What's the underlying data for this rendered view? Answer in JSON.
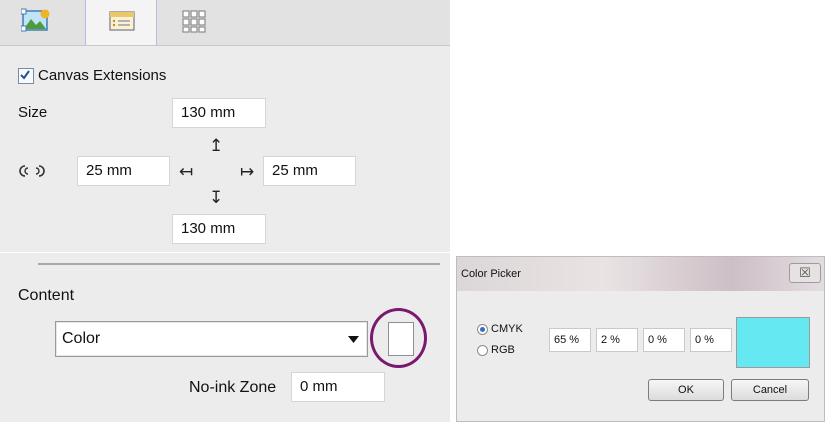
{
  "tabs": [
    {
      "icon": "image-icon",
      "selected": false
    },
    {
      "icon": "layout-icon",
      "selected": true
    },
    {
      "icon": "grid-icon",
      "selected": false
    }
  ],
  "canvas_extensions": {
    "label": "Canvas Extensions",
    "checked": true,
    "size_label": "Size",
    "link_icon": "link-icon",
    "top_value": "130 mm",
    "left_value": "25 mm",
    "right_value": "25 mm",
    "bottom_value": "130 mm",
    "arrow_up": "↥",
    "arrow_left": "↤",
    "arrow_right": "↦",
    "arrow_down": "↧"
  },
  "content": {
    "label": "Content",
    "select_value": "Color",
    "no_ink_label": "No-ink Zone",
    "no_ink_value": "0 mm",
    "swatch_color": "#ffffff",
    "highlight_color": "#7a1a6e"
  },
  "color_picker": {
    "title": "Color Picker",
    "close_glyph": "☒",
    "modes": [
      {
        "label": "CMYK",
        "selected": true
      },
      {
        "label": "RGB",
        "selected": false
      }
    ],
    "values": [
      "65 %",
      "2 %",
      "0 %",
      "0 %"
    ],
    "preview_color": "#66e8f2",
    "ok_label": "OK",
    "cancel_label": "Cancel"
  }
}
